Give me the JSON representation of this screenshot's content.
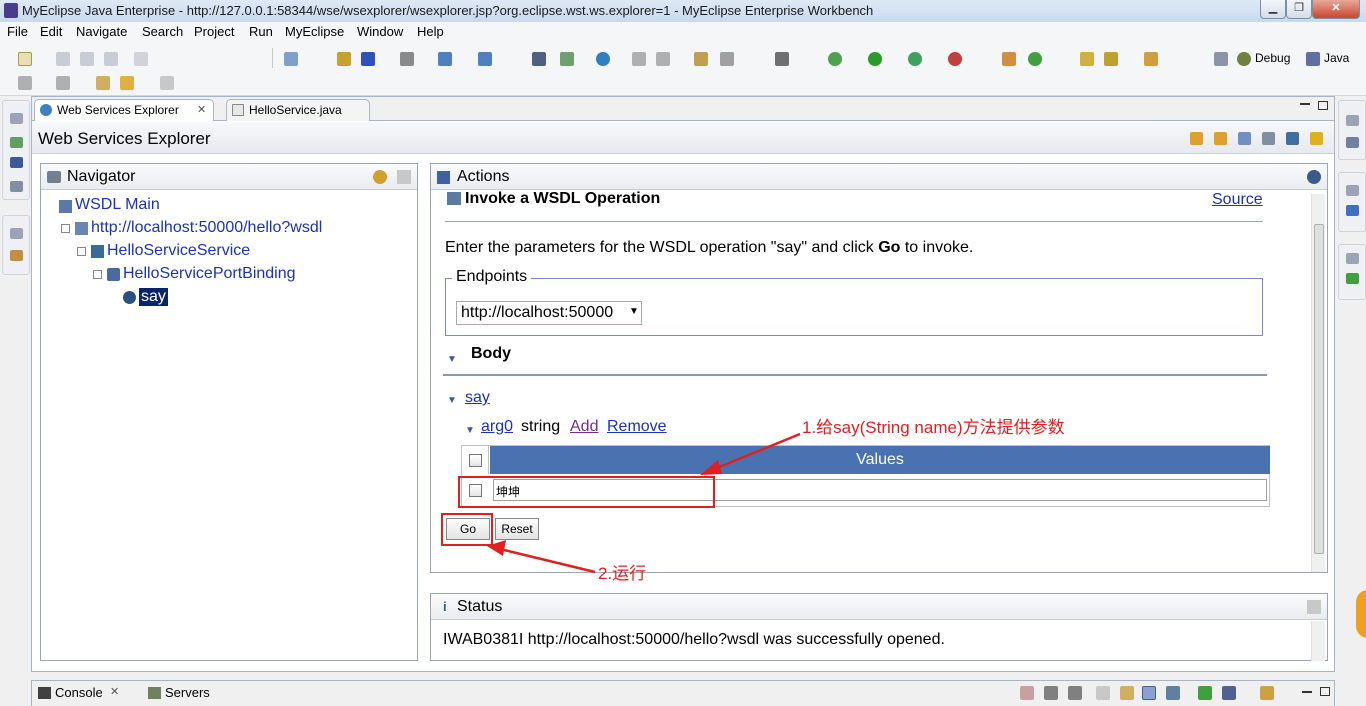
{
  "window": {
    "title": "MyEclipse Java Enterprise - http://127.0.0.1:58344/wse/wsexplorer/wsexplorer.jsp?org.eclipse.wst.ws.explorer=1 - MyEclipse Enterprise Workbench",
    "minimize": "▁",
    "maximize": "❐",
    "close": "✕"
  },
  "menu": [
    "File",
    "Edit",
    "Navigate",
    "Search",
    "Project",
    "Run",
    "MyEclipse",
    "Window",
    "Help"
  ],
  "perspectives": {
    "debug": "Debug",
    "java": "Java"
  },
  "tabs": [
    {
      "label": "Web Services Explorer",
      "close": "✕"
    },
    {
      "label": "HelloService.java"
    }
  ],
  "explorer_title": "Web Services Explorer",
  "navigator": {
    "title": "Navigator",
    "items": [
      {
        "label": "WSDL Main",
        "icon": "wsdl-main-icon"
      },
      {
        "label": "http://localhost:50000/hello?wsdl",
        "icon": "wsdl-url-icon"
      },
      {
        "label": "HelloServiceService",
        "icon": "service-icon"
      },
      {
        "label": "HelloServicePortBinding",
        "icon": "binding-icon"
      },
      {
        "label": "say",
        "icon": "operation-icon"
      }
    ]
  },
  "actions": {
    "title": "Actions",
    "heading": "Invoke a WSDL Operation",
    "source_link": "Source",
    "intro_before": "Enter the parameters for the WSDL operation \"say\" and click ",
    "intro_bold": "Go",
    "intro_after": " to invoke.",
    "endpoints_legend": "Endpoints",
    "endpoint_value": "http://localhost:50000",
    "body_label": "Body",
    "operation_link": "say",
    "arg_link": "arg0",
    "arg_type": "string",
    "add_link": "Add",
    "remove_link": "Remove",
    "values_header": "Values",
    "value_input": "坤坤",
    "go_button": "Go",
    "reset_button": "Reset"
  },
  "annotations": {
    "step1": "1.给say(String name)方法提供参数",
    "step2": "2.运行"
  },
  "status": {
    "title": "Status",
    "message": "IWAB0381I http://localhost:50000/hello?wsdl was successfully opened."
  },
  "bottom_tabs": [
    {
      "label": "Console",
      "close": "✕"
    },
    {
      "label": "Servers"
    }
  ],
  "colors": {
    "link": "#1a33b8",
    "values_header_bg": "#4a72b0",
    "annotation": "#e02020",
    "selection": "#0a246a"
  }
}
